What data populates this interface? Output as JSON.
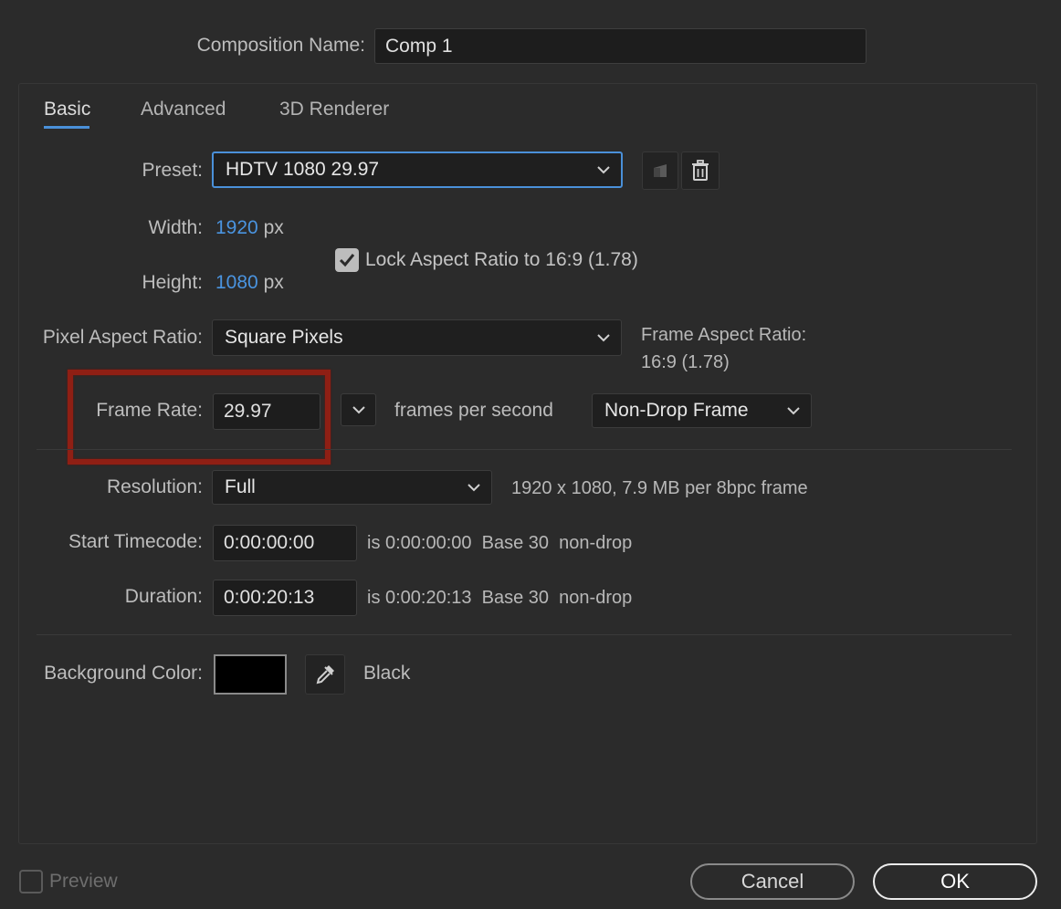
{
  "composition": {
    "label": "Composition Name:",
    "value": "Comp 1"
  },
  "tabs": [
    {
      "label": "Basic",
      "active": true
    },
    {
      "label": "Advanced",
      "active": false
    },
    {
      "label": "3D Renderer",
      "active": false
    }
  ],
  "preset": {
    "label": "Preset:",
    "value": "HDTV 1080 29.97"
  },
  "width": {
    "label": "Width:",
    "value": "1920",
    "unit": "px"
  },
  "height": {
    "label": "Height:",
    "value": "1080",
    "unit": "px"
  },
  "lock_aspect": {
    "label": "Lock Aspect Ratio to 16:9 (1.78)",
    "checked": true
  },
  "pixel_aspect": {
    "label": "Pixel Aspect Ratio:",
    "value": "Square Pixels"
  },
  "frame_aspect": {
    "label": "Frame Aspect Ratio:",
    "value": "16:9 (1.78)"
  },
  "frame_rate": {
    "label": "Frame Rate:",
    "value": "29.97",
    "unit_label": "frames per second",
    "mode": "Non-Drop Frame"
  },
  "resolution": {
    "label": "Resolution:",
    "value": "Full",
    "info": "1920 x 1080, 7.9 MB per 8bpc frame"
  },
  "start_timecode": {
    "label": "Start Timecode:",
    "value": "0:00:00:00",
    "is_text": "is 0:00:00:00",
    "base": "Base 30",
    "drop": "non-drop"
  },
  "duration": {
    "label": "Duration:",
    "value": "0:00:20:13",
    "is_text": "is 0:00:20:13",
    "base": "Base 30",
    "drop": "non-drop"
  },
  "background": {
    "label": "Background Color:",
    "color_name": "Black",
    "swatch": "#000000"
  },
  "preview": {
    "label": "Preview",
    "checked": false
  },
  "buttons": {
    "cancel": "Cancel",
    "ok": "OK"
  },
  "colors": {
    "accent": "#4a90d9",
    "highlight_box": "#8f1f14"
  }
}
